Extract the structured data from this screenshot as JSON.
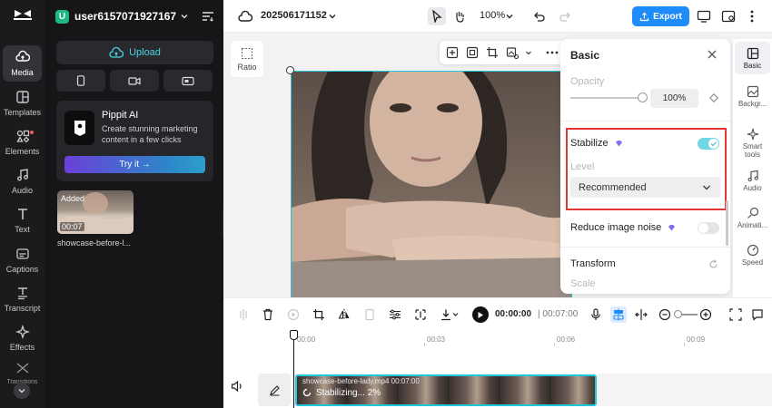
{
  "rail": {
    "items": [
      {
        "label": "Media"
      },
      {
        "label": "Templates"
      },
      {
        "label": "Elements"
      },
      {
        "label": "Audio"
      },
      {
        "label": "Text"
      },
      {
        "label": "Captions"
      },
      {
        "label": "Transcript"
      },
      {
        "label": "Effects"
      },
      {
        "label": "Transitions"
      }
    ]
  },
  "panel": {
    "user_initial": "U",
    "user_name": "user6157071927167'...",
    "upload_label": "Upload",
    "promo": {
      "title": "Pippit AI",
      "description": "Create stunning marketing content in a few clicks",
      "button": "Try it →"
    },
    "media": {
      "badge": "Added",
      "duration": "00:07",
      "filename": "showcase-before-l..."
    }
  },
  "topbar": {
    "project_name": "202506171152",
    "zoom": "100%",
    "export_label": "Export"
  },
  "canvas": {
    "ratio_label": "Ratio"
  },
  "props": {
    "title": "Basic",
    "opacity_label": "Opacity",
    "opacity_value": "100%",
    "stabilize_label": "Stabilize",
    "level_label": "Level",
    "level_value": "Recommended",
    "noise_label": "Reduce image noise",
    "transform_label": "Transform",
    "scale_label": "Scale"
  },
  "right_rail": {
    "items": [
      {
        "label": "Basic"
      },
      {
        "label": "Backgr..."
      },
      {
        "label": "Smart tools"
      },
      {
        "label": "Audio"
      },
      {
        "label": "Animati..."
      },
      {
        "label": "Speed"
      }
    ]
  },
  "timeline_toolbar": {
    "current_time": "00:00:00",
    "total_time": "| 00:07:00"
  },
  "timeline": {
    "ruler": [
      "00:00",
      "00:03",
      "00:06",
      "00:09"
    ],
    "clip_name": "showcase-before-lady.mp4   00:07:00",
    "clip_status": "Stabilizing... 2%"
  },
  "colors": {
    "accent": "#21c7da",
    "export": "#1d8cf8",
    "highlight": "#e23535",
    "rail_bg": "#1b1b1d"
  }
}
